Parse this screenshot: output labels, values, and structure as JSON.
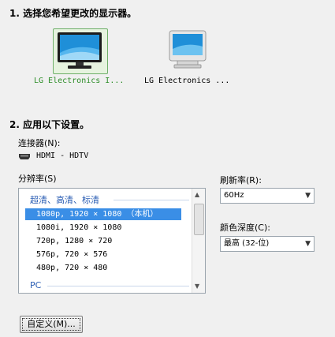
{
  "step1": {
    "title": "1. 选择您希望更改的显示器。"
  },
  "monitors": [
    {
      "label": "LG Electronics I...",
      "selected": true
    },
    {
      "label": "LG Electronics ...",
      "selected": false
    }
  ],
  "step2": {
    "title": "2. 应用以下设置。"
  },
  "connector": {
    "label": "连接器(N):",
    "value": "HDMI - HDTV",
    "icon": "hdmi-connector-icon"
  },
  "resolution": {
    "label": "分辨率(S)",
    "groups": [
      {
        "header": "超清、高清、标清",
        "items": [
          "1080p, 1920 × 1080 （本机）",
          "1080i, 1920 × 1080",
          "720p, 1280 × 720",
          "576p, 720 × 576",
          "480p, 720 × 480"
        ]
      },
      {
        "header": "PC",
        "items": []
      }
    ],
    "selected_index": 0
  },
  "refresh": {
    "label": "刷新率(R):",
    "value": "60Hz"
  },
  "color_depth": {
    "label": "颜色深度(C):",
    "value": "最高 (32-位)"
  },
  "custom_button": {
    "label": "自定义(M)..."
  },
  "colors": {
    "selection": "#3a8ee6",
    "selected_monitor_text": "#2f8f2a",
    "group_header": "#2a5db3"
  }
}
